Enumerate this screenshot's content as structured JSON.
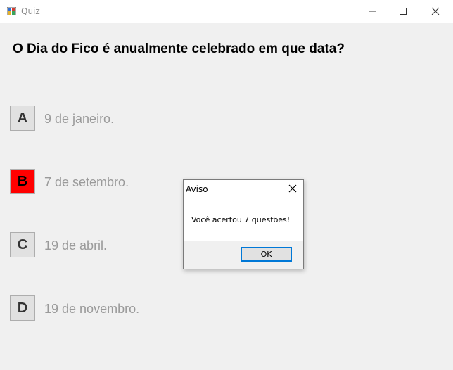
{
  "window": {
    "title": "Quiz",
    "controls": [
      "minimize-icon",
      "maximize-icon",
      "close-icon"
    ]
  },
  "quiz": {
    "question": "O Dia do Fico é anualmente celebrado em que data?",
    "options": [
      {
        "letter": "A",
        "text": "9 de janeiro.",
        "selected": false
      },
      {
        "letter": "B",
        "text": "7 de setembro.",
        "selected": true
      },
      {
        "letter": "C",
        "text": "19 de abril.",
        "selected": false
      },
      {
        "letter": "D",
        "text": "19 de novembro.",
        "selected": false
      }
    ]
  },
  "dialog": {
    "title": "Aviso",
    "message": "Você acertou 7 questões!",
    "ok_label": "OK"
  },
  "colors": {
    "selected_option": "#ff0000",
    "dialog_focus_border": "#0078d7"
  }
}
